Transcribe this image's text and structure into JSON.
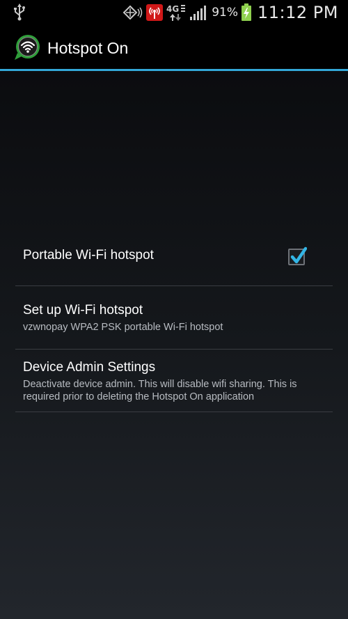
{
  "status_bar": {
    "battery_percent": "91%",
    "time": "11:12 PM",
    "network_label": "4G",
    "icons": [
      "usb-icon",
      "nfc-icon",
      "hotspot-status-icon",
      "data-transfer-icon",
      "signal-icon",
      "battery-charging-icon"
    ]
  },
  "action_bar": {
    "title": "Hotspot On",
    "accent_color": "#33a8d8",
    "icon": "wifi-app-icon"
  },
  "preferences": {
    "hotspot_toggle": {
      "title": "Portable Wi-Fi hotspot",
      "checked": true
    },
    "setup": {
      "title": "Set up Wi-Fi hotspot",
      "summary": "vzwnopay WPA2 PSK portable Wi-Fi hotspot"
    },
    "device_admin": {
      "title": "Device Admin Settings",
      "summary": "Deactivate device admin. This will disable wifi sharing. This is required prior to deleting the Hotspot On application"
    }
  }
}
